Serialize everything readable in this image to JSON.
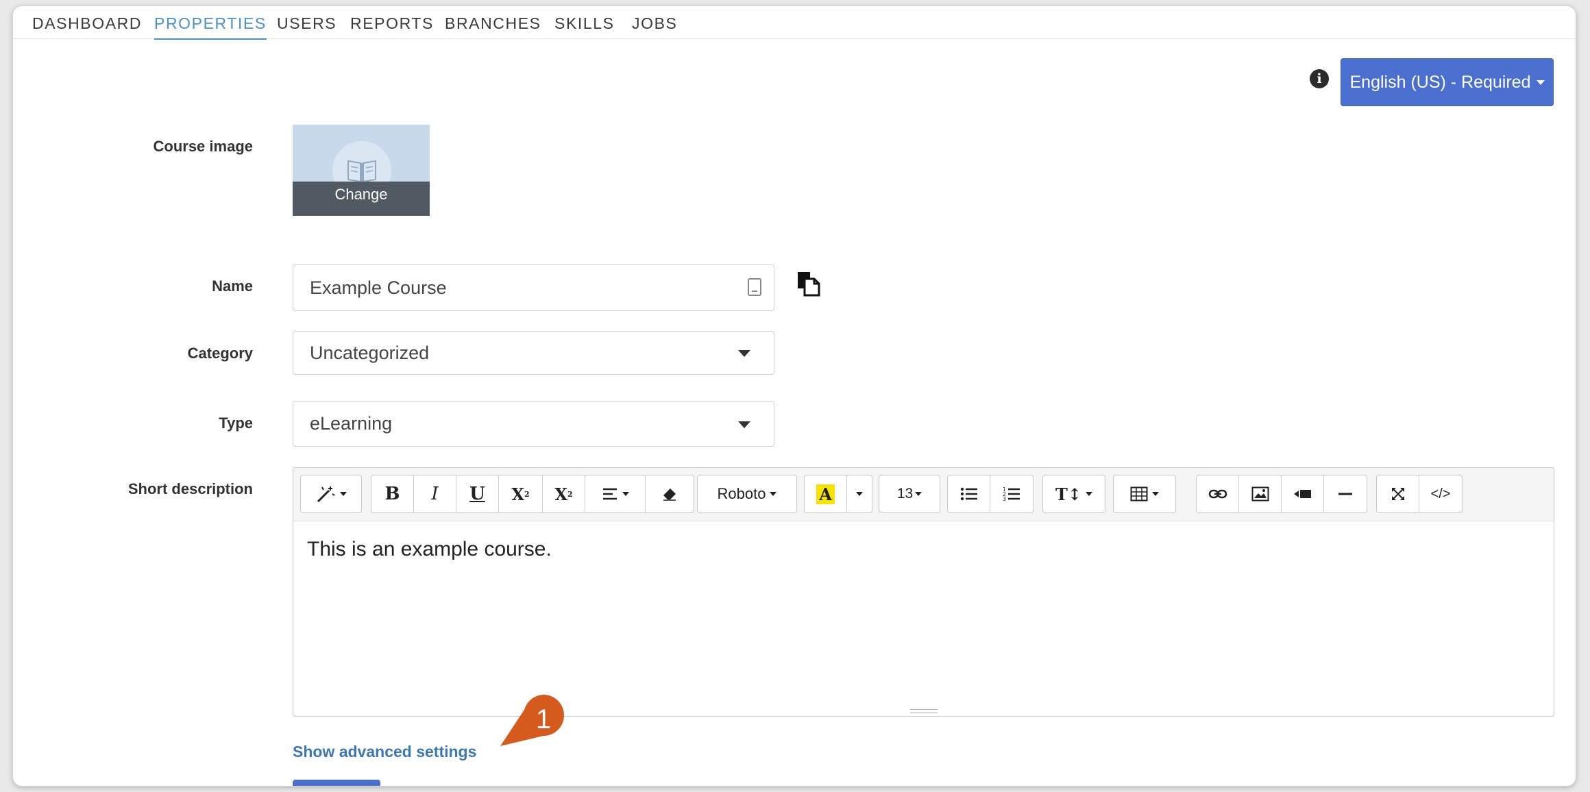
{
  "tabs": [
    {
      "label": "DASHBOARD",
      "active": false
    },
    {
      "label": "PROPERTIES",
      "active": true
    },
    {
      "label": "USERS",
      "active": false
    },
    {
      "label": "REPORTS",
      "active": false
    },
    {
      "label": "BRANCHES",
      "active": false
    },
    {
      "label": "SKILLS",
      "active": false
    },
    {
      "label": "JOBS",
      "active": false
    }
  ],
  "language": {
    "info_icon": "info-icon",
    "button_label": "English (US) - Required"
  },
  "form": {
    "course_image": {
      "label": "Course image",
      "change_label": "Change",
      "placeholder_icon": "book-icon"
    },
    "name": {
      "label": "Name",
      "value": "Example Course"
    },
    "category": {
      "label": "Category",
      "value": "Uncategorized"
    },
    "type": {
      "label": "Type",
      "value": "eLearning"
    },
    "short_description": {
      "label": "Short description",
      "content": "This is an example course.",
      "toolbar": {
        "font": "Roboto",
        "font_size": "13",
        "bold": "B",
        "italic": "I",
        "underline": "U",
        "code": "</>"
      }
    }
  },
  "advanced_link": "Show advanced settings",
  "callout": {
    "number": "1",
    "color": "#d45a1e"
  },
  "colors": {
    "accent": "#4a6fcf",
    "tab_active": "#4a90c8",
    "link": "#3b78b4",
    "highlight": "#f5e400"
  }
}
